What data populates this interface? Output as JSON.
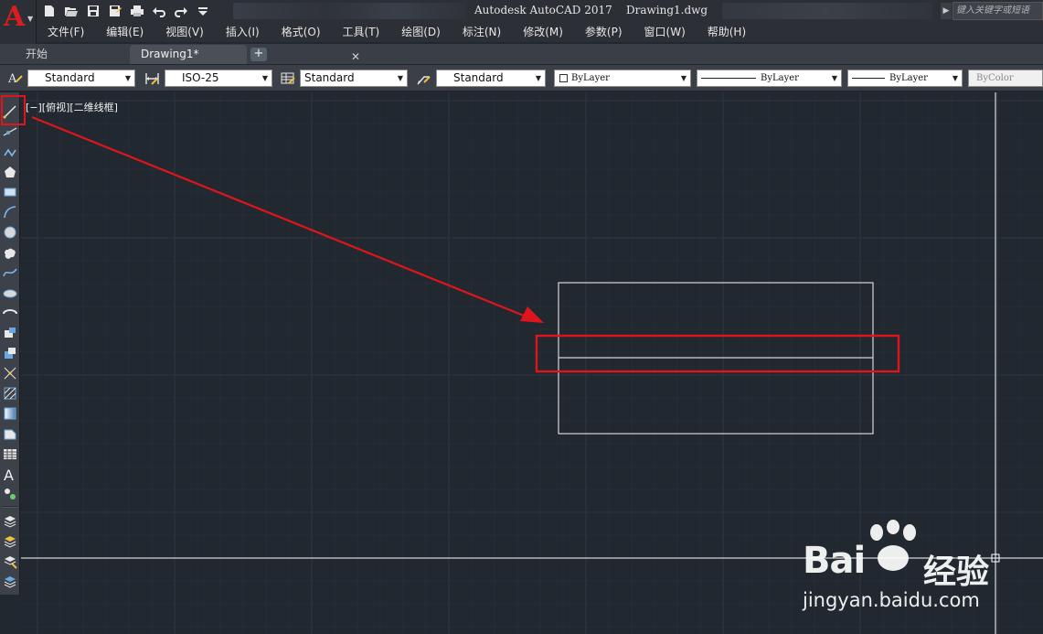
{
  "app": {
    "logo_letter": "A",
    "title": "Autodesk AutoCAD 2017    Drawing1.dwg",
    "search_placeholder": "键入关键字或短语"
  },
  "quick_access": [
    "new-icon",
    "open-icon",
    "save-icon",
    "save-as-icon",
    "plot-icon",
    "undo-icon",
    "redo-icon",
    "customize-icon"
  ],
  "menu": [
    "文件(F)",
    "编辑(E)",
    "视图(V)",
    "插入(I)",
    "格式(O)",
    "工具(T)",
    "绘图(D)",
    "标注(N)",
    "修改(M)",
    "参数(P)",
    "窗口(W)",
    "帮助(H)"
  ],
  "tabs": {
    "start": "开始",
    "drawing": "Drawing1*",
    "close": "✕",
    "add": "+"
  },
  "styles_toolbar": {
    "text_style": "Standard",
    "dim_style": "ISO-25",
    "table_style": "Standard",
    "mleader_style": "Standard",
    "color": "ByLayer",
    "linetype": "ByLayer",
    "lineweight": "ByLayer",
    "plotstyle": "ByColor"
  },
  "left_tools": [
    "line-icon",
    "construction-line-icon",
    "polyline-icon",
    "polygon-icon",
    "rectangle-icon",
    "arc-icon",
    "circle-icon",
    "revision-cloud-icon",
    "spline-icon",
    "ellipse-icon",
    "ellipse-arc-icon",
    "insert-block-icon",
    "make-block-icon",
    "point-icon",
    "hatch-icon",
    "gradient-icon",
    "region-icon",
    "table-icon",
    "multiline-text-icon",
    "add-selected-icon",
    "layer-properties-icon",
    "layer-state-icon",
    "layer-isolate-icon",
    "layer-walk-icon"
  ],
  "viewport_label": "[−][俯视][二维线框]",
  "colors": {
    "canvas": "#212830",
    "highlight": "#e0141c",
    "grid_major": "#2d3641",
    "grid_minor": "#252d37",
    "geometry": "#d6d6d6",
    "crosshair": "#ffffff"
  },
  "watermark": {
    "brand": "Bai",
    "brand_suffix": "经验",
    "url": "jingyan.baidu.com"
  }
}
